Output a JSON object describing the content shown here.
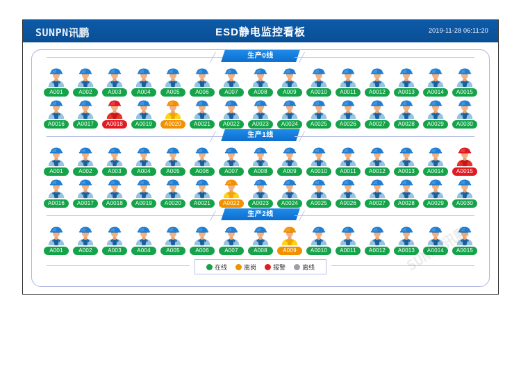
{
  "header": {
    "logo_text": "SUNPN",
    "logo_cn": "讯鹏",
    "title": "ESD静电监控看板",
    "datetime": "2019-11-28 06:11:20"
  },
  "watermark": "SUNPN讯鹏",
  "status_colors": {
    "online": "#15a349",
    "away": "#f29100",
    "alarm": "#e11b22",
    "offline": "#9aa0a6"
  },
  "legend": {
    "items": [
      {
        "label": "在线",
        "status": "online"
      },
      {
        "label": "离岗",
        "status": "away"
      },
      {
        "label": "报警",
        "status": "alarm"
      },
      {
        "label": "离线",
        "status": "offline"
      }
    ]
  },
  "sections": [
    {
      "name": "生产0线",
      "rows": [
        [
          {
            "id": "A001",
            "status": "online"
          },
          {
            "id": "A002",
            "status": "online"
          },
          {
            "id": "A003",
            "status": "online"
          },
          {
            "id": "A004",
            "status": "online"
          },
          {
            "id": "A005",
            "status": "online"
          },
          {
            "id": "A006",
            "status": "online"
          },
          {
            "id": "A007",
            "status": "online"
          },
          {
            "id": "A008",
            "status": "online"
          },
          {
            "id": "A009",
            "status": "online"
          },
          {
            "id": "A0010",
            "status": "online"
          },
          {
            "id": "A0011",
            "status": "online"
          },
          {
            "id": "A0012",
            "status": "online"
          },
          {
            "id": "A0013",
            "status": "online"
          },
          {
            "id": "A0014",
            "status": "online"
          },
          {
            "id": "A0015",
            "status": "online"
          }
        ],
        [
          {
            "id": "A0016",
            "status": "online"
          },
          {
            "id": "A0017",
            "status": "online"
          },
          {
            "id": "A0018",
            "status": "alarm"
          },
          {
            "id": "A0019",
            "status": "online"
          },
          {
            "id": "A0020",
            "status": "away"
          },
          {
            "id": "A0021",
            "status": "online"
          },
          {
            "id": "A0022",
            "status": "online"
          },
          {
            "id": "A0023",
            "status": "online"
          },
          {
            "id": "A0024",
            "status": "online"
          },
          {
            "id": "A0025",
            "status": "online"
          },
          {
            "id": "A0026",
            "status": "online"
          },
          {
            "id": "A0027",
            "status": "online"
          },
          {
            "id": "A0028",
            "status": "online"
          },
          {
            "id": "A0029",
            "status": "online"
          },
          {
            "id": "A0030",
            "status": "online"
          }
        ]
      ]
    },
    {
      "name": "生产1线",
      "rows": [
        [
          {
            "id": "A001",
            "status": "online"
          },
          {
            "id": "A002",
            "status": "online"
          },
          {
            "id": "A003",
            "status": "online"
          },
          {
            "id": "A004",
            "status": "online"
          },
          {
            "id": "A005",
            "status": "online"
          },
          {
            "id": "A006",
            "status": "online"
          },
          {
            "id": "A007",
            "status": "online"
          },
          {
            "id": "A008",
            "status": "online"
          },
          {
            "id": "A009",
            "status": "online"
          },
          {
            "id": "A0010",
            "status": "online"
          },
          {
            "id": "A0011",
            "status": "online"
          },
          {
            "id": "A0012",
            "status": "online"
          },
          {
            "id": "A0013",
            "status": "online"
          },
          {
            "id": "A0014",
            "status": "online"
          },
          {
            "id": "A0015",
            "status": "alarm"
          }
        ],
        [
          {
            "id": "A0016",
            "status": "online"
          },
          {
            "id": "A0017",
            "status": "online"
          },
          {
            "id": "A0018",
            "status": "online"
          },
          {
            "id": "A0019",
            "status": "online"
          },
          {
            "id": "A0020",
            "status": "online"
          },
          {
            "id": "A0021",
            "status": "online"
          },
          {
            "id": "A0022",
            "status": "away"
          },
          {
            "id": "A0023",
            "status": "online"
          },
          {
            "id": "A0024",
            "status": "online"
          },
          {
            "id": "A0025",
            "status": "online"
          },
          {
            "id": "A0026",
            "status": "online"
          },
          {
            "id": "A0027",
            "status": "online"
          },
          {
            "id": "A0028",
            "status": "online"
          },
          {
            "id": "A0029",
            "status": "online"
          },
          {
            "id": "A0030",
            "status": "online"
          }
        ]
      ]
    },
    {
      "name": "生产2线",
      "rows": [
        [
          {
            "id": "A001",
            "status": "online"
          },
          {
            "id": "A002",
            "status": "online"
          },
          {
            "id": "A003",
            "status": "online"
          },
          {
            "id": "A004",
            "status": "online"
          },
          {
            "id": "A005",
            "status": "online"
          },
          {
            "id": "A006",
            "status": "online"
          },
          {
            "id": "A007",
            "status": "online"
          },
          {
            "id": "A008",
            "status": "online"
          },
          {
            "id": "A009",
            "status": "away"
          },
          {
            "id": "A0010",
            "status": "online"
          },
          {
            "id": "A0011",
            "status": "online"
          },
          {
            "id": "A0012",
            "status": "online"
          },
          {
            "id": "A0013",
            "status": "online"
          },
          {
            "id": "A0014",
            "status": "online"
          },
          {
            "id": "A0015",
            "status": "online"
          }
        ]
      ]
    }
  ]
}
